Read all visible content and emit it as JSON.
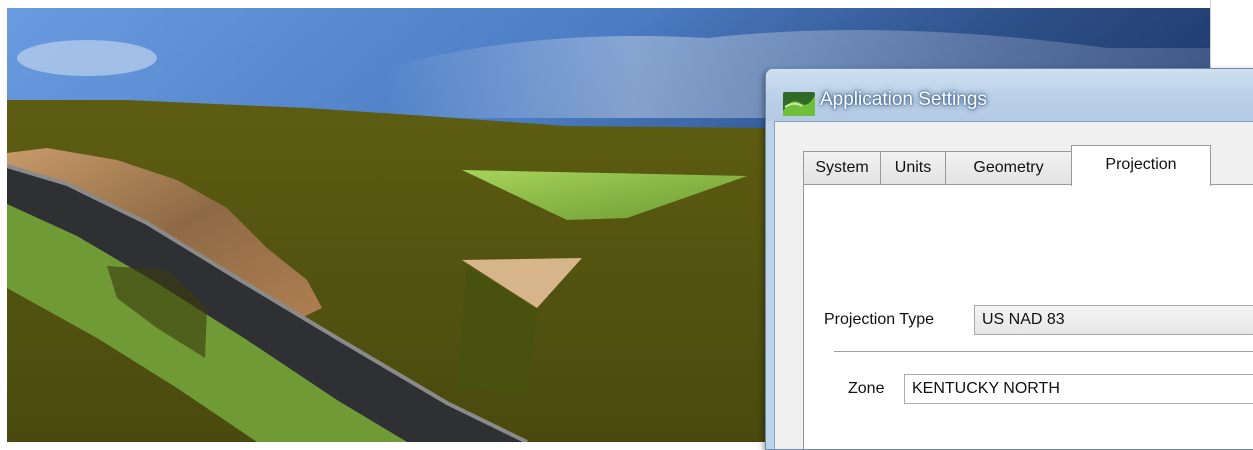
{
  "dialog": {
    "title": "Application Settings",
    "icon": "terrain-app-icon",
    "tabs": [
      {
        "label": "System",
        "active": false
      },
      {
        "label": "Units",
        "active": false
      },
      {
        "label": "Geometry",
        "active": false
      },
      {
        "label": "Projection",
        "active": true
      }
    ],
    "projection": {
      "type_label": "Projection Type",
      "type_value": "US NAD 83",
      "zone_label": "Zone",
      "zone_value": "KENTUCKY NORTH"
    }
  },
  "colors": {
    "sky": "#4a78b8",
    "terrain": "#5a5a14",
    "road": "#2f3033",
    "grass": "#8ec447",
    "dirt": "#b8875a"
  }
}
